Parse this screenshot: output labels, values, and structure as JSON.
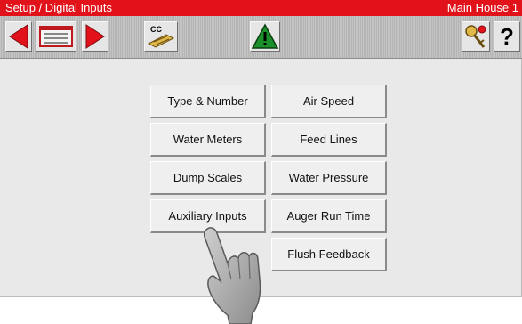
{
  "titlebar": {
    "breadcrumb": "Setup / Digital Inputs",
    "location": "Main House 1"
  },
  "toolbar": {
    "icons": [
      "back-arrow-icon",
      "menu-list-icon",
      "forward-arrow-icon",
      "cc-keyboard-icon",
      "alarm-warning-icon",
      "key-login-icon",
      "help-icon"
    ],
    "help_label": "?",
    "cc_label": "CC",
    "accent_red": "#e2121b",
    "warning_green": "#1a8f2a"
  },
  "menu": {
    "left_column": [
      "Type & Number",
      "Water Meters",
      "Dump Scales",
      "Auxiliary Inputs"
    ],
    "right_column": [
      "Air Speed",
      "Feed Lines",
      "Water Pressure",
      "Auger Run Time",
      "Flush Feedback"
    ]
  }
}
